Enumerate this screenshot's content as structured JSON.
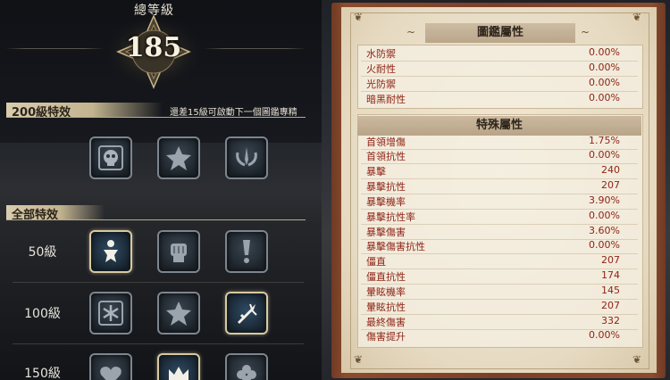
{
  "header": {
    "title": "總等級",
    "level": "185"
  },
  "tier200": {
    "title": "200級特效",
    "hint": "還差15級可啟動下一個圖鑑專精"
  },
  "all_effects": {
    "title": "全部特效"
  },
  "tiers": [
    {
      "label": "",
      "icons": [
        {
          "name": "skull-icon",
          "active": false
        },
        {
          "name": "star-icon",
          "active": false
        },
        {
          "name": "sword-wings-icon",
          "active": false
        }
      ]
    },
    {
      "label": "50級",
      "icons": [
        {
          "name": "figure-icon",
          "active": true
        },
        {
          "name": "fist-icon",
          "active": false
        },
        {
          "name": "exclamation-blade-icon",
          "active": false
        }
      ]
    },
    {
      "label": "100級",
      "icons": [
        {
          "name": "snowflake-icon",
          "active": false
        },
        {
          "name": "star-icon",
          "active": false
        },
        {
          "name": "sword-strike-icon",
          "active": true
        }
      ]
    },
    {
      "label": "150級",
      "icons": [
        {
          "name": "heart-icon",
          "active": false
        },
        {
          "name": "crown-icon",
          "active": true
        },
        {
          "name": "flower-icon",
          "active": false
        }
      ]
    }
  ],
  "codex": {
    "title": "圖鑑屬性",
    "attributes": [
      {
        "name": "水防禦",
        "value": "0.00%"
      },
      {
        "name": "火耐性",
        "value": "0.00%"
      },
      {
        "name": "光防禦",
        "value": "0.00%"
      },
      {
        "name": "暗黑耐性",
        "value": "0.00%"
      }
    ],
    "special_title": "特殊屬性",
    "special": [
      {
        "name": "首領增傷",
        "value": "1.75%"
      },
      {
        "name": "首領抗性",
        "value": "0.00%"
      },
      {
        "name": "暴擊",
        "value": "240"
      },
      {
        "name": "暴擊抗性",
        "value": "207"
      },
      {
        "name": "暴擊機率",
        "value": "3.90%"
      },
      {
        "name": "暴擊抗性率",
        "value": "0.00%"
      },
      {
        "name": "暴擊傷害",
        "value": "3.60%"
      },
      {
        "name": "暴擊傷害抗性",
        "value": "0.00%"
      },
      {
        "name": "僵直",
        "value": "207"
      },
      {
        "name": "僵直抗性",
        "value": "174"
      },
      {
        "name": "暈眩機率",
        "value": "145"
      },
      {
        "name": "暈眩抗性",
        "value": "207"
      },
      {
        "name": "最終傷害",
        "value": "332"
      },
      {
        "name": "傷害提升",
        "value": "0.00%"
      }
    ]
  },
  "colors": {
    "stat_text": "#8e2417",
    "icon_active_border": "#d7c9a2",
    "paper": "#ece3cf"
  }
}
